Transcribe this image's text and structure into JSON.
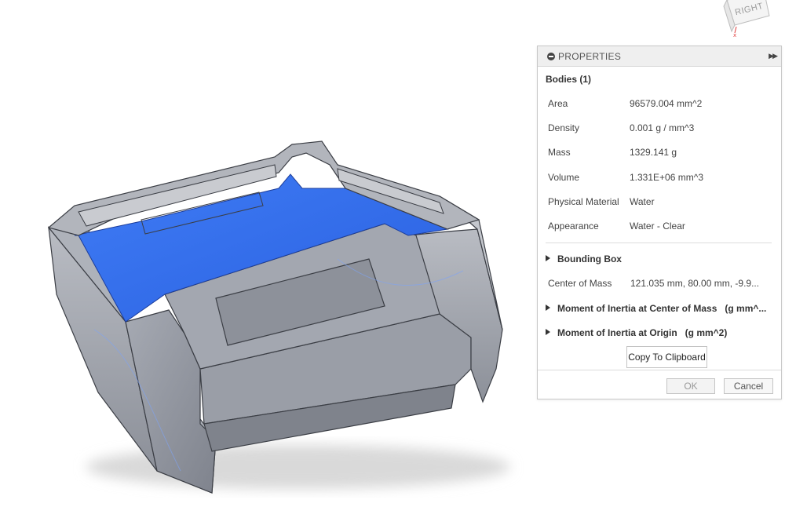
{
  "viewcube": {
    "face_label": "RIGHT"
  },
  "panel": {
    "title": "PROPERTIES",
    "bodies_header": "Bodies (1)",
    "rows": [
      {
        "key": "Area",
        "value": "96579.004 mm^2"
      },
      {
        "key": "Density",
        "value": "0.001 g / mm^3"
      },
      {
        "key": "Mass",
        "value": "1329.141 g"
      },
      {
        "key": "Volume",
        "value": "1.331E+06 mm^3"
      },
      {
        "key": "Physical Material",
        "value": "Water"
      },
      {
        "key": "Appearance",
        "value": "Water - Clear"
      }
    ],
    "bounding_box": "Bounding Box",
    "center_of_mass": {
      "key": "Center of Mass",
      "value": "121.035 mm, 80.00 mm, -9.9..."
    },
    "moment_center": "Moment of Inertia at Center of Mass   (g mm^...",
    "moment_origin": "Moment of Inertia at Origin   (g mm^2)",
    "copy_label": "Copy To Clipboard",
    "ok_label": "OK",
    "cancel_label": "Cancel"
  },
  "colors": {
    "model_gray": "#9ea2aa",
    "model_dark": "#6a6e78",
    "highlight_blue": "#2f6ef0",
    "panel_border": "#c8c8c8"
  }
}
